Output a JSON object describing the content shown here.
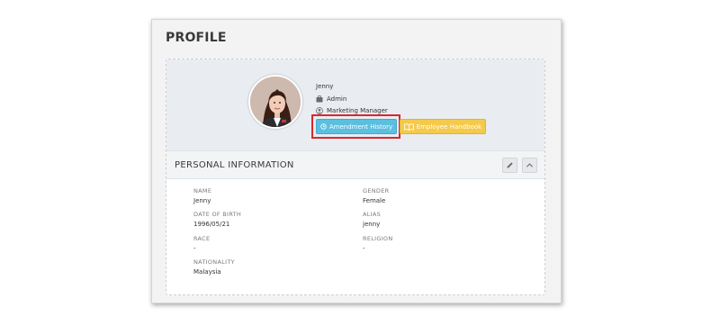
{
  "page": {
    "title": "PROFILE"
  },
  "profile": {
    "name": "Jenny",
    "role": "Admin",
    "position": "Marketing Manager",
    "buttons": {
      "amendment_history": "Amendment History",
      "employee_handbook": "Employee Handbook"
    }
  },
  "section": {
    "title": "PERSONAL INFORMATION",
    "fields": [
      {
        "label": "NAME",
        "value": "Jenny"
      },
      {
        "label": "GENDER",
        "value": "Female"
      },
      {
        "label": "DATE OF BIRTH",
        "value": "1996/05/21"
      },
      {
        "label": "ALIAS",
        "value": "jenny"
      },
      {
        "label": "RACE",
        "value": "-"
      },
      {
        "label": "RELIGION",
        "value": "-"
      },
      {
        "label": "NATIONALITY",
        "value": "Malaysia"
      }
    ]
  },
  "colors": {
    "amendment_button": "#5bbfe0",
    "handbook_button": "#f5c94a",
    "highlight_border": "#d9272e"
  },
  "icons": {
    "role": "briefcase-icon",
    "position": "user-circle-icon",
    "amendment": "clock-icon",
    "handbook": "book-open-icon",
    "edit": "pencil-icon",
    "collapse": "chevron-up-icon"
  }
}
